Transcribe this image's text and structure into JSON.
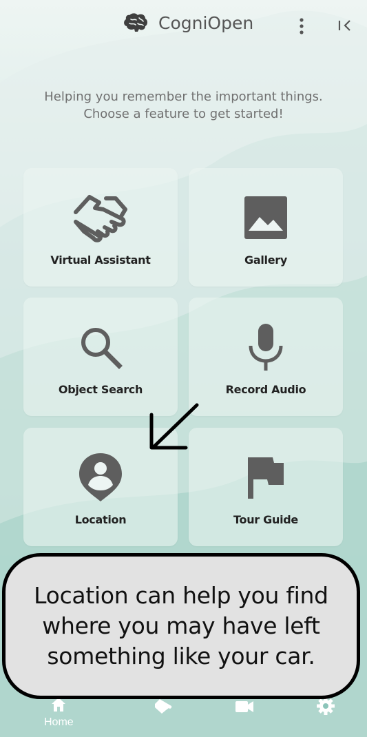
{
  "app": {
    "title": "CogniOpen"
  },
  "tagline": {
    "line1": "Helping you remember the important things.",
    "line2": "Choose a feature to get started!"
  },
  "features": [
    {
      "label": "Virtual Assistant",
      "icon": "handshake-icon"
    },
    {
      "label": "Gallery",
      "icon": "image-icon"
    },
    {
      "label": "Object Search",
      "icon": "search-icon"
    },
    {
      "label": "Record Audio",
      "icon": "microphone-icon"
    },
    {
      "label": "Location",
      "icon": "location-pin-icon"
    },
    {
      "label": "Tour Guide",
      "icon": "flag-icon"
    }
  ],
  "bottom_nav": {
    "home_label": "Home"
  },
  "callout": {
    "line1": "Location can help you find",
    "line2": "where you may have left",
    "line3": "something like your car."
  },
  "colors": {
    "icon": "#5e5e5e",
    "accent_bg": "#8cc5ba",
    "callout_bg": "#e2e2e2"
  }
}
